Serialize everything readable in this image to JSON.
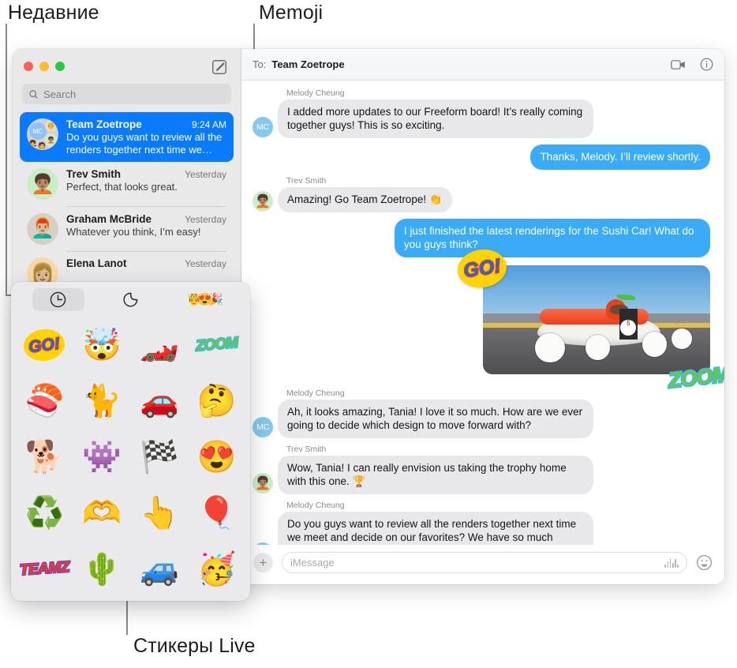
{
  "callouts": [
    {
      "id": "recents",
      "text": "Недавние"
    },
    {
      "id": "memoji",
      "text": "Memoji"
    },
    {
      "id": "live_stickers",
      "text": "Стикеры Live"
    }
  ],
  "sidebar": {
    "window_controls": [
      "close",
      "minimize",
      "zoom"
    ],
    "compose_icon": "compose-icon",
    "search": {
      "placeholder": "Search",
      "icon": "search-icon"
    },
    "conversations": [
      {
        "name": "Team Zoetrope",
        "time": "9:24 AM",
        "preview": "Do you guys want to review all the renders together next time we meet…",
        "selected": true,
        "avatar_type": "group",
        "avatar_initials": "MC"
      },
      {
        "name": "Trev Smith",
        "time": "Yesterday",
        "preview": "Perfect, that looks great.",
        "selected": false,
        "avatar_type": "memoji",
        "avatar_glyph": "🧑🏽‍🦱"
      },
      {
        "name": "Graham McBride",
        "time": "Yesterday",
        "preview": "Whatever you think, I’m easy!",
        "selected": false,
        "avatar_type": "photo",
        "avatar_glyph": "👨🏼‍🦰"
      },
      {
        "name": "Elena Lanot",
        "time": "Yesterday",
        "preview": "",
        "selected": false,
        "avatar_type": "photo",
        "avatar_glyph": "👩🏼"
      }
    ]
  },
  "chat": {
    "to_label": "To:",
    "to_name": "Team Zoetrope",
    "facetime_icon": "video-camera-icon",
    "info_icon": "info-icon",
    "messages": [
      {
        "direction": "in",
        "sender": "Melody Cheung",
        "avatar_initials": "MC",
        "text": "I added more updates to our Freeform board! It’s really coming together guys! This is so exciting."
      },
      {
        "direction": "out",
        "sender": "",
        "text": "Thanks, Melody. I’ll review shortly."
      },
      {
        "direction": "in",
        "sender": "Trev Smith",
        "avatar_glyph": "🧑🏽‍🦱",
        "text": "Amazing! Go Team Zoetrope! 👏"
      },
      {
        "direction": "out",
        "sender": "",
        "text": "I just finished the latest renderings for the Sushi Car! What do you guys think?"
      },
      {
        "direction": "in",
        "sender": "Melody Cheung",
        "avatar_initials": "MC",
        "text": "Ah, it looks amazing, Tania! I love it so much. How are we ever going to decide which design to move forward with?"
      },
      {
        "direction": "in",
        "sender": "Trev Smith",
        "avatar_glyph": "🧑🏽‍🦱",
        "text": "Wow, Tania! I can really envision us taking the trophy home with this one. 🏆"
      },
      {
        "direction": "in",
        "sender": "Melody Cheung",
        "avatar_initials": "MC",
        "text": "Do you guys want to review all the renders together next time we meet and decide on our favorites? We have so much amazing work now, just need to make some decisions."
      }
    ],
    "attachment": {
      "description": "sushi-soapbox-race-car-photo",
      "car_number": "5",
      "stickers": [
        {
          "name": "go-sticker",
          "text": "GO!"
        },
        {
          "name": "zoom-sticker",
          "text": "ZOOM"
        }
      ]
    }
  },
  "composer": {
    "plus_label": "+",
    "placeholder": "iMessage",
    "audio_icon": "audio-waveform-icon",
    "emoji_icon": "smiley-icon"
  },
  "sticker_picker": {
    "tabs": [
      {
        "name": "recents-tab",
        "icon": "clock-icon",
        "active": true
      },
      {
        "name": "live-stickers-tab",
        "icon": "sticker-peel-icon",
        "active": false
      },
      {
        "name": "memoji-tab",
        "icon": "memoji-faces-icon",
        "active": false
      }
    ],
    "memoji_tab_glyphs": [
      "🤴",
      "😍",
      "🎉"
    ],
    "stickers": [
      {
        "name": "go-sticker",
        "kind": "label",
        "style": "go",
        "text": "GO!"
      },
      {
        "name": "mind-blown-memoji",
        "kind": "emoji",
        "glyph": "🤯"
      },
      {
        "name": "race-car-sticker",
        "kind": "emoji",
        "glyph": "🏎️"
      },
      {
        "name": "zoom-sticker",
        "kind": "label",
        "style": "zoom",
        "text": "ZOOM"
      },
      {
        "name": "sushi-sticker",
        "kind": "emoji",
        "glyph": "🍣"
      },
      {
        "name": "grumpy-cat-sticker",
        "kind": "emoji",
        "glyph": "🐈"
      },
      {
        "name": "flaming-car-sticker",
        "kind": "emoji",
        "glyph": "🚗"
      },
      {
        "name": "thinking-memoji",
        "kind": "emoji",
        "glyph": "🤔"
      },
      {
        "name": "dog-sunglasses-sticker",
        "kind": "emoji",
        "glyph": "🐕"
      },
      {
        "name": "monster-teeth-sticker",
        "kind": "emoji",
        "glyph": "👾"
      },
      {
        "name": "checkered-flag-sticker",
        "kind": "emoji",
        "glyph": "🏁"
      },
      {
        "name": "heart-eyes-memoji",
        "kind": "emoji",
        "glyph": "😍"
      },
      {
        "name": "recycle-sticker",
        "kind": "emoji",
        "glyph": "♻️"
      },
      {
        "name": "heart-hands-memoji",
        "kind": "emoji",
        "glyph": "🫶"
      },
      {
        "name": "foam-finger-sticker",
        "kind": "emoji",
        "glyph": "👆"
      },
      {
        "name": "hot-air-balloon-sticker",
        "kind": "emoji",
        "glyph": "🎈"
      },
      {
        "name": "teamz-sticker",
        "kind": "label",
        "style": "teamz",
        "text": "TEAMZ"
      },
      {
        "name": "cactus-sticker",
        "kind": "emoji",
        "glyph": "🌵"
      },
      {
        "name": "blue-car-sticker",
        "kind": "emoji",
        "glyph": "🚙"
      },
      {
        "name": "party-horn-memoji",
        "kind": "emoji",
        "glyph": "🥳"
      }
    ]
  },
  "colors": {
    "accent_blue": "#0a7bff",
    "bubble_out": "#3aabf7",
    "bubble_in": "#e8e8ea",
    "sidebar_bg": "#e9e9ea",
    "callout_line": "#86868b"
  }
}
